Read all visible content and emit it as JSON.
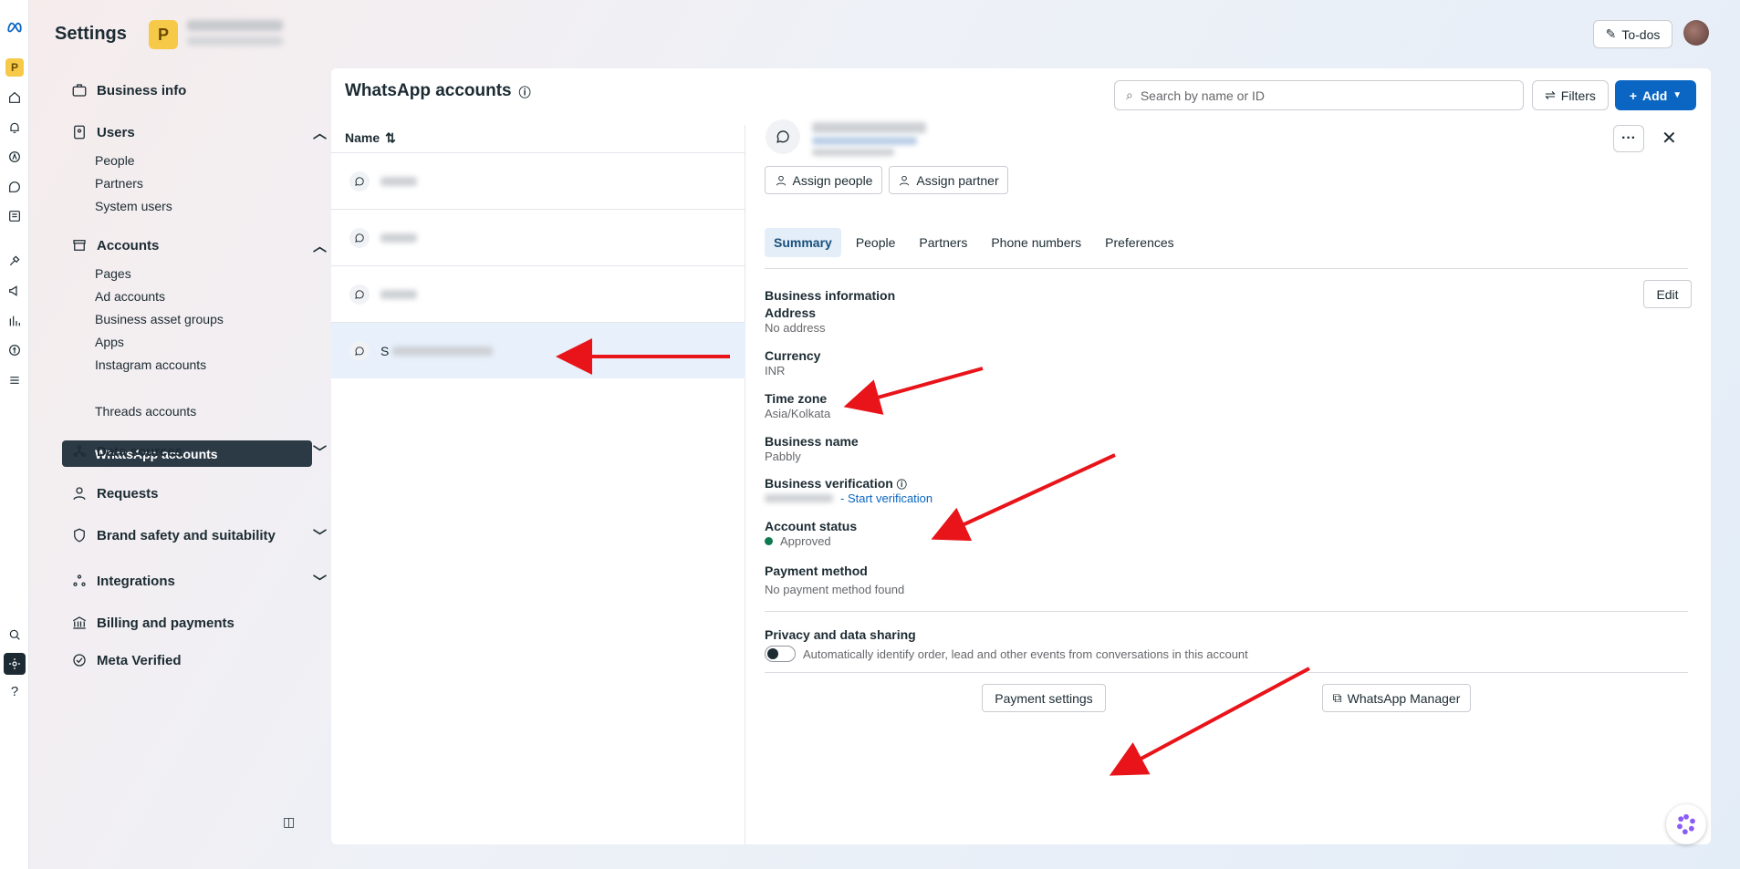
{
  "header": {
    "title": "Settings",
    "business_initial": "P",
    "todos_label": "To-dos"
  },
  "nav": {
    "business_info": "Business info",
    "users": {
      "label": "Users",
      "items": [
        "People",
        "Partners",
        "System users"
      ]
    },
    "accounts": {
      "label": "Accounts",
      "items": [
        "Pages",
        "Ad accounts",
        "Business asset groups",
        "Apps",
        "Instagram accounts",
        "WhatsApp accounts",
        "Threads accounts"
      ]
    },
    "data_sources": "Data sources",
    "requests": "Requests",
    "brand_safety": "Brand safety and suitability",
    "integrations": "Integrations",
    "billing": "Billing and payments",
    "meta_verified": "Meta Verified"
  },
  "page": {
    "title": "WhatsApp accounts",
    "search_placeholder": "Search by name or ID",
    "filters_label": "Filters",
    "add_label": "Add"
  },
  "list": {
    "column_name": "Name",
    "selected_row_prefix": "S"
  },
  "detail": {
    "assign_people": "Assign people",
    "assign_partner": "Assign partner",
    "tabs": [
      "Summary",
      "People",
      "Partners",
      "Phone numbers",
      "Preferences"
    ],
    "section_title": "Business information",
    "edit_label": "Edit",
    "address_label": "Address",
    "address_value": "No address",
    "currency_label": "Currency",
    "currency_value": "INR",
    "timezone_label": "Time zone",
    "timezone_value": "Asia/Kolkata",
    "bizname_label": "Business name",
    "bizname_value": "Pabbly",
    "verification_label": "Business verification",
    "verification_link": "- Start verification",
    "status_label": "Account status",
    "status_value": "Approved",
    "payment_label": "Payment method",
    "payment_value": "No payment method found",
    "privacy_label": "Privacy and data sharing",
    "privacy_text": "Automatically identify order, lead and other events from conversations in this account",
    "payment_settings": "Payment settings",
    "wa_manager": "WhatsApp Manager"
  },
  "colors": {
    "accent": "#0a66c2",
    "active_nav": "#2b3a45",
    "approved": "#0f7a4f",
    "annotation_arrow": "#e8141a"
  }
}
